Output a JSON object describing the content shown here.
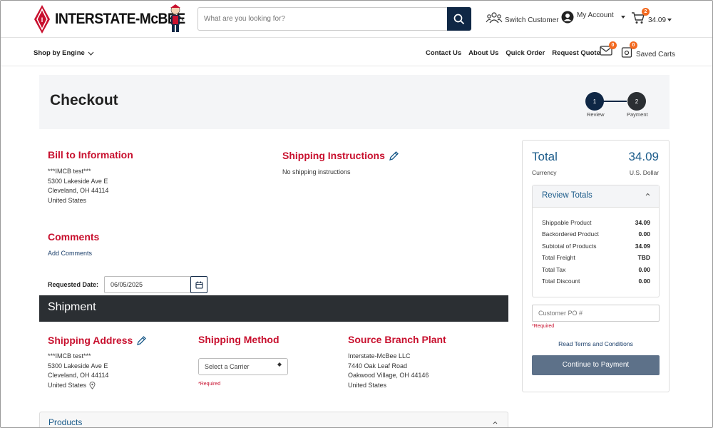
{
  "header": {
    "brand": "INTERSTATE-McBEE",
    "search_placeholder": "What are you looking for?",
    "switch_customer": "Switch Customer",
    "my_account": "My Account",
    "cart_count": "2",
    "cart_total": "34.09",
    "shop_by_engine": "Shop by Engine",
    "nav_links": [
      "Contact Us",
      "About Us",
      "Quick Order",
      "Request Quote"
    ],
    "messages_count": "0",
    "saved_carts_count": "0",
    "saved_carts": "Saved Carts"
  },
  "checkout": {
    "title": "Checkout",
    "steps": [
      {
        "number": "1",
        "label": "Review"
      },
      {
        "number": "2",
        "label": "Payment"
      }
    ]
  },
  "bill_to": {
    "heading": "Bill to Information",
    "lines": [
      "***IMCB test***",
      "5300 Lakeside Ave E",
      "Cleveland, OH 44114",
      "United States"
    ]
  },
  "shipping_instructions": {
    "heading": "Shipping Instructions",
    "text": "No shipping instructions"
  },
  "comments": {
    "heading": "Comments",
    "add_link": "Add Comments"
  },
  "requested_date": {
    "label": "Requested Date:",
    "value": "06/05/2025"
  },
  "shipment": {
    "heading": "Shipment",
    "shipping_address": {
      "heading": "Shipping Address",
      "lines": [
        "***IMCB test***",
        "5300 Lakeside Ave E",
        "Cleveland, OH 44114",
        "United States"
      ]
    },
    "shipping_method": {
      "heading": "Shipping Method",
      "select_value": "Select a Carrier",
      "required": "*Required"
    },
    "source_branch": {
      "heading": "Source Branch Plant",
      "lines": [
        "Interstate-McBee LLC",
        "7440 Oak Leaf Road",
        "Oakwood Village, OH 44146",
        "United States"
      ]
    },
    "products_heading": "Products"
  },
  "summary": {
    "total_label": "Total",
    "total_value": "34.09",
    "currency_label": "Currency",
    "currency_value": "U.S. Dollar",
    "review_heading": "Review Totals",
    "rows": [
      {
        "label": "Shippable Product",
        "value": "34.09"
      },
      {
        "label": "Backordered Product",
        "value": "0.00"
      },
      {
        "label": "Subtotal of Products",
        "value": "34.09"
      },
      {
        "label": "Total Freight",
        "value": "TBD"
      },
      {
        "label": "Total Tax",
        "value": "0.00"
      },
      {
        "label": "Total Discount",
        "value": "0.00"
      }
    ],
    "po_placeholder": "Customer PO #",
    "required": "*Required",
    "terms_link": "Read Terms and Conditions",
    "continue_button": "Continue to Payment"
  },
  "colors": {
    "brand_red": "#c8102e",
    "navy": "#0f2745",
    "link_blue": "#1b5b8a",
    "button_slate": "#5d7189",
    "badge_orange": "#f26a21"
  }
}
